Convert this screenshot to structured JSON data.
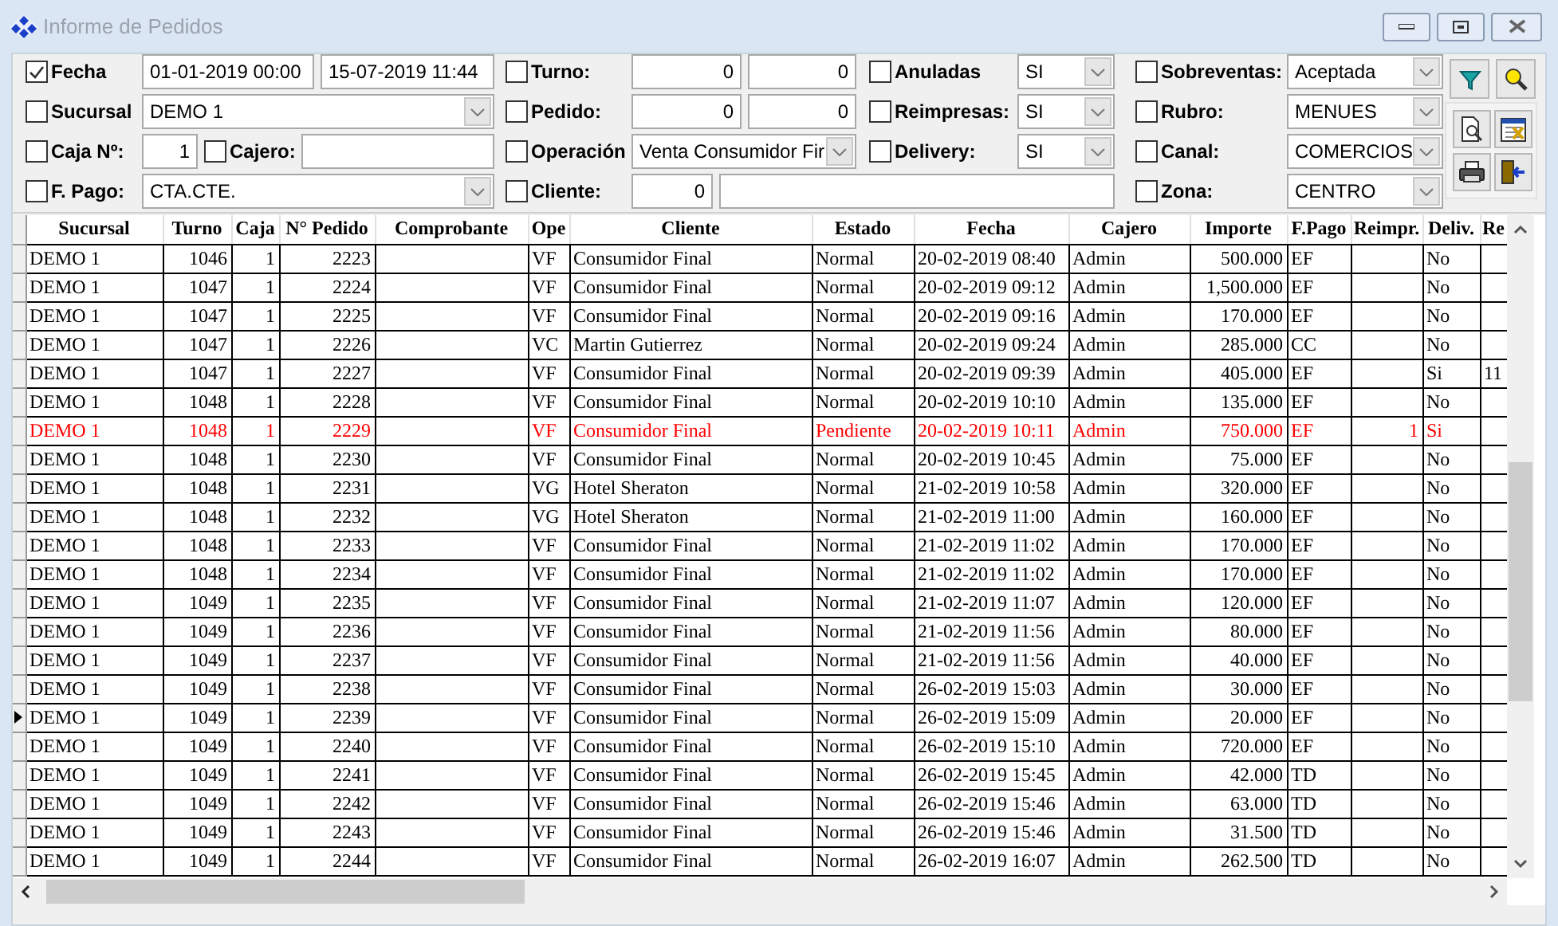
{
  "window": {
    "title": "Informe de Pedidos"
  },
  "filters": [
    [
      {
        "kind": "check",
        "label": "Fecha",
        "checked": true
      },
      {
        "kind": "field",
        "value": "01-01-2019 00:00"
      },
      {
        "kind": "field",
        "value": "15-07-2019 11:44"
      },
      {
        "kind": "check",
        "label": "Turno:",
        "checked": false
      },
      {
        "kind": "number",
        "value": "0"
      },
      {
        "kind": "number",
        "value": "0"
      },
      {
        "kind": "check",
        "label": "Anuladas",
        "checked": false
      },
      {
        "kind": "combo",
        "value": "SI"
      },
      {
        "kind": "check",
        "label": "Sobreventas:",
        "checked": false
      },
      {
        "kind": "combo",
        "value": "Aceptada"
      }
    ],
    [
      {
        "kind": "check",
        "label": "Sucursal",
        "checked": false
      },
      {
        "kind": "combo",
        "value": "DEMO 1"
      },
      {
        "kind": "check",
        "label": "Pedido:",
        "checked": false
      },
      {
        "kind": "number",
        "value": "0"
      },
      {
        "kind": "number",
        "value": "0"
      },
      {
        "kind": "check",
        "label": "Reimpresas:",
        "checked": false
      },
      {
        "kind": "combo",
        "value": "SI"
      },
      {
        "kind": "check",
        "label": "Rubro:",
        "checked": false
      },
      {
        "kind": "combo",
        "value": "MENUES"
      }
    ],
    [
      {
        "kind": "check",
        "label": "Caja Nº:",
        "checked": false
      },
      {
        "kind": "number",
        "value": "1"
      },
      {
        "kind": "check",
        "label": "Cajero:",
        "checked": false
      },
      {
        "kind": "field"
      },
      {
        "kind": "check",
        "label": "Operación",
        "checked": false
      },
      {
        "kind": "combo",
        "value": "Venta Consumidor Fir"
      },
      {
        "kind": "check",
        "label": "Delivery:",
        "checked": false
      },
      {
        "kind": "combo",
        "value": "SI"
      },
      {
        "kind": "check",
        "label": "Canal:",
        "checked": false
      },
      {
        "kind": "combo",
        "value": "COMERCIOS"
      }
    ],
    [
      {
        "kind": "check",
        "label": "F. Pago:",
        "checked": false
      },
      {
        "kind": "combo",
        "value": "CTA.CTE."
      },
      {
        "kind": "check",
        "label": "Cliente:",
        "checked": false
      },
      {
        "kind": "number",
        "value": "0"
      },
      {
        "kind": "field"
      },
      {
        "kind": "check",
        "label": "Zona:",
        "checked": false
      },
      {
        "kind": "combo",
        "value": "CENTRO"
      }
    ]
  ],
  "table": {
    "columns": [
      "Sucursal",
      "Turno",
      "Caja",
      "N° Pedido",
      "Comprobante",
      "Ope",
      "Cliente",
      "Estado",
      "Fecha",
      "Cajero",
      "Importe",
      "F.Pago",
      "Reimpr.",
      "Deliv.",
      "Re"
    ],
    "rows": [
      {
        "sucursal": "DEMO 1",
        "turno": "1046",
        "caja": "1",
        "pedido": "2223",
        "ope": "VF",
        "cliente": "Consumidor Final",
        "estado": "Normal",
        "fecha": "20-02-2019 08:40",
        "cajero": "Admin",
        "importe": "500.000",
        "f_pago": "EF",
        "deliv": "No",
        "selected": false,
        "highlighted": false
      },
      {
        "sucursal": "DEMO 1",
        "turno": "1047",
        "caja": "1",
        "pedido": "2224",
        "ope": "VF",
        "cliente": "Consumidor Final",
        "estado": "Normal",
        "fecha": "20-02-2019 09:12",
        "cajero": "Admin",
        "importe": "1,500.000",
        "f_pago": "EF",
        "deliv": "No",
        "selected": false,
        "highlighted": false
      },
      {
        "sucursal": "DEMO 1",
        "turno": "1047",
        "caja": "1",
        "pedido": "2225",
        "ope": "VF",
        "cliente": "Consumidor Final",
        "estado": "Normal",
        "fecha": "20-02-2019 09:16",
        "cajero": "Admin",
        "importe": "170.000",
        "f_pago": "EF",
        "deliv": "No",
        "selected": false,
        "highlighted": false
      },
      {
        "sucursal": "DEMO 1",
        "turno": "1047",
        "caja": "1",
        "pedido": "2226",
        "ope": "VC",
        "cliente": "Martin Gutierrez",
        "estado": "Normal",
        "fecha": "20-02-2019 09:24",
        "cajero": "Admin",
        "importe": "285.000",
        "f_pago": "CC",
        "deliv": "No",
        "selected": false,
        "highlighted": false
      },
      {
        "sucursal": "DEMO 1",
        "turno": "1047",
        "caja": "1",
        "pedido": "2227",
        "ope": "VF",
        "cliente": "Consumidor Final",
        "estado": "Normal",
        "fecha": "20-02-2019 09:39",
        "cajero": "Admin",
        "importe": "405.000",
        "f_pago": "EF",
        "deliv": "Si",
        "re": "11",
        "selected": false,
        "highlighted": false
      },
      {
        "sucursal": "DEMO 1",
        "turno": "1048",
        "caja": "1",
        "pedido": "2228",
        "ope": "VF",
        "cliente": "Consumidor Final",
        "estado": "Normal",
        "fecha": "20-02-2019 10:10",
        "cajero": "Admin",
        "importe": "135.000",
        "f_pago": "EF",
        "deliv": "No",
        "selected": false,
        "highlighted": false
      },
      {
        "sucursal": "DEMO 1",
        "turno": "1048",
        "caja": "1",
        "pedido": "2229",
        "ope": "VF",
        "cliente": "Consumidor Final",
        "estado": "Pendiente",
        "fecha": "20-02-2019 10:11",
        "cajero": "Admin",
        "importe": "750.000",
        "f_pago": "EF",
        "reimpr": "1",
        "deliv": "Si",
        "selected": false,
        "highlighted": true
      },
      {
        "sucursal": "DEMO 1",
        "turno": "1048",
        "caja": "1",
        "pedido": "2230",
        "ope": "VF",
        "cliente": "Consumidor Final",
        "estado": "Normal",
        "fecha": "20-02-2019 10:45",
        "cajero": "Admin",
        "importe": "75.000",
        "f_pago": "EF",
        "deliv": "No",
        "selected": false,
        "highlighted": false
      },
      {
        "sucursal": "DEMO 1",
        "turno": "1048",
        "caja": "1",
        "pedido": "2231",
        "ope": "VG",
        "cliente": "Hotel Sheraton",
        "estado": "Normal",
        "fecha": "21-02-2019 10:58",
        "cajero": "Admin",
        "importe": "320.000",
        "f_pago": "EF",
        "deliv": "No",
        "selected": false,
        "highlighted": false
      },
      {
        "sucursal": "DEMO 1",
        "turno": "1048",
        "caja": "1",
        "pedido": "2232",
        "ope": "VG",
        "cliente": "Hotel Sheraton",
        "estado": "Normal",
        "fecha": "21-02-2019 11:00",
        "cajero": "Admin",
        "importe": "160.000",
        "f_pago": "EF",
        "deliv": "No",
        "selected": false,
        "highlighted": false
      },
      {
        "sucursal": "DEMO 1",
        "turno": "1048",
        "caja": "1",
        "pedido": "2233",
        "ope": "VF",
        "cliente": "Consumidor Final",
        "estado": "Normal",
        "fecha": "21-02-2019 11:02",
        "cajero": "Admin",
        "importe": "170.000",
        "f_pago": "EF",
        "deliv": "No",
        "selected": false,
        "highlighted": false
      },
      {
        "sucursal": "DEMO 1",
        "turno": "1048",
        "caja": "1",
        "pedido": "2234",
        "ope": "VF",
        "cliente": "Consumidor Final",
        "estado": "Normal",
        "fecha": "21-02-2019 11:02",
        "cajero": "Admin",
        "importe": "170.000",
        "f_pago": "EF",
        "deliv": "No",
        "selected": false,
        "highlighted": false
      },
      {
        "sucursal": "DEMO 1",
        "turno": "1049",
        "caja": "1",
        "pedido": "2235",
        "ope": "VF",
        "cliente": "Consumidor Final",
        "estado": "Normal",
        "fecha": "21-02-2019 11:07",
        "cajero": "Admin",
        "importe": "120.000",
        "f_pago": "EF",
        "deliv": "No",
        "selected": false,
        "highlighted": false
      },
      {
        "sucursal": "DEMO 1",
        "turno": "1049",
        "caja": "1",
        "pedido": "2236",
        "ope": "VF",
        "cliente": "Consumidor Final",
        "estado": "Normal",
        "fecha": "21-02-2019 11:56",
        "cajero": "Admin",
        "importe": "80.000",
        "f_pago": "EF",
        "deliv": "No",
        "selected": false,
        "highlighted": false
      },
      {
        "sucursal": "DEMO 1",
        "turno": "1049",
        "caja": "1",
        "pedido": "2237",
        "ope": "VF",
        "cliente": "Consumidor Final",
        "estado": "Normal",
        "fecha": "21-02-2019 11:56",
        "cajero": "Admin",
        "importe": "40.000",
        "f_pago": "EF",
        "deliv": "No",
        "selected": false,
        "highlighted": false
      },
      {
        "sucursal": "DEMO 1",
        "turno": "1049",
        "caja": "1",
        "pedido": "2238",
        "ope": "VF",
        "cliente": "Consumidor Final",
        "estado": "Normal",
        "fecha": "26-02-2019 15:03",
        "cajero": "Admin",
        "importe": "30.000",
        "f_pago": "EF",
        "deliv": "No",
        "selected": false,
        "highlighted": false
      },
      {
        "sucursal": "DEMO 1",
        "turno": "1049",
        "caja": "1",
        "pedido": "2239",
        "ope": "VF",
        "cliente": "Consumidor Final",
        "estado": "Normal",
        "fecha": "26-02-2019 15:09",
        "cajero": "Admin",
        "importe": "20.000",
        "f_pago": "EF",
        "deliv": "No",
        "selected": true,
        "highlighted": false
      },
      {
        "sucursal": "DEMO 1",
        "turno": "1049",
        "caja": "1",
        "pedido": "2240",
        "ope": "VF",
        "cliente": "Consumidor Final",
        "estado": "Normal",
        "fecha": "26-02-2019 15:10",
        "cajero": "Admin",
        "importe": "720.000",
        "f_pago": "EF",
        "deliv": "No",
        "selected": false,
        "highlighted": false
      },
      {
        "sucursal": "DEMO 1",
        "turno": "1049",
        "caja": "1",
        "pedido": "2241",
        "ope": "VF",
        "cliente": "Consumidor Final",
        "estado": "Normal",
        "fecha": "26-02-2019 15:45",
        "cajero": "Admin",
        "importe": "42.000",
        "f_pago": "TD",
        "deliv": "No",
        "selected": false,
        "highlighted": false
      },
      {
        "sucursal": "DEMO 1",
        "turno": "1049",
        "caja": "1",
        "pedido": "2242",
        "ope": "VF",
        "cliente": "Consumidor Final",
        "estado": "Normal",
        "fecha": "26-02-2019 15:46",
        "cajero": "Admin",
        "importe": "63.000",
        "f_pago": "TD",
        "deliv": "No",
        "selected": false,
        "highlighted": false
      },
      {
        "sucursal": "DEMO 1",
        "turno": "1049",
        "caja": "1",
        "pedido": "2243",
        "ope": "VF",
        "cliente": "Consumidor Final",
        "estado": "Normal",
        "fecha": "26-02-2019 15:46",
        "cajero": "Admin",
        "importe": "31.500",
        "f_pago": "TD",
        "deliv": "No",
        "selected": false,
        "highlighted": false
      },
      {
        "sucursal": "DEMO 1",
        "turno": "1049",
        "caja": "1",
        "pedido": "2244",
        "ope": "VF",
        "cliente": "Consumidor Final",
        "estado": "Normal",
        "fecha": "26-02-2019 16:07",
        "cajero": "Admin",
        "importe": "262.500",
        "f_pago": "TD",
        "deliv": "No",
        "selected": false,
        "highlighted": false
      }
    ]
  }
}
